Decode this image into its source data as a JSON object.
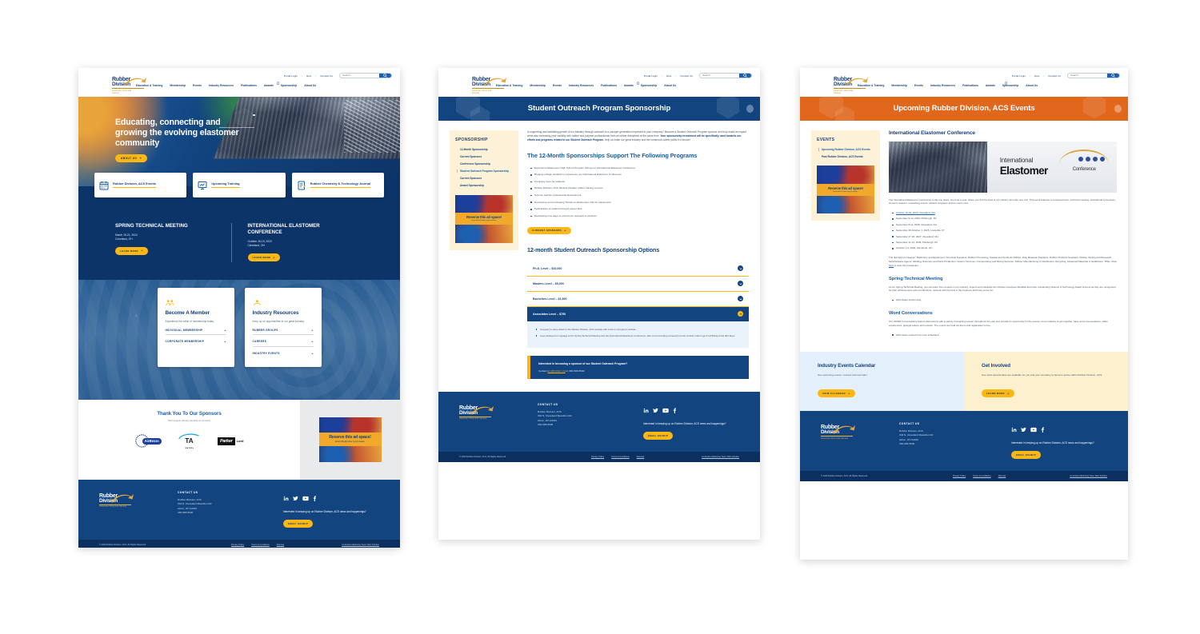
{
  "site": {
    "utility": {
      "portal_login": "Portal Login",
      "give": "Give",
      "contact": "Contact Us",
      "sep": "|"
    },
    "search": {
      "placeholder": "Search...",
      "value": "",
      "icon": "search-icon"
    },
    "logo": {
      "line1": "Rubber",
      "line2": "Division",
      "tagline": "American Chemical Society"
    },
    "nav": [
      "Education & Training",
      "Membership",
      "Events",
      "Industry Resources",
      "Publications",
      "Awards",
      "Sponsorship",
      "About Us"
    ]
  },
  "ad": {
    "headline": "Reserve this ad space!",
    "subline": "Email office@rubber.org for details."
  },
  "home": {
    "hero": {
      "heading": "Educating, connecting and growing the evolving elastomer community",
      "cta": "ABOUT US"
    },
    "quick_cards": [
      {
        "label": "Rubber Division, ACS Events",
        "icon": "calendar-icon"
      },
      {
        "label": "Upcoming Training",
        "icon": "presentation-icon"
      },
      {
        "label": "Rubber Chemistry & Technology Journal",
        "icon": "journal-icon"
      }
    ],
    "events": [
      {
        "title": "SPRING TECHNICAL MEETING",
        "date": "March 19-21, 2024",
        "location": "Columbus, OH",
        "cta": "LEARN MORE"
      },
      {
        "title": "INTERNATIONAL ELASTOMER CONFERENCE",
        "date": "October 16-19, 2023",
        "location": "Cleveland, OH",
        "cta": "LEARN MORE"
      }
    ],
    "member_cards": [
      {
        "icon": "people-icon",
        "title": "Become A Member",
        "desc": "Experience the value of membership today.",
        "links": [
          "INDIVIDUAL MEMBERSHIP",
          "CORPORATE MEMBERSHIP"
        ]
      },
      {
        "icon": "handshake-icon",
        "title": "Industry Resources",
        "desc": "Keep up on opportunities in our great industry.",
        "links": [
          "RUBBER GROUPS",
          "CAREERS",
          "INDUSTRY EVENTS"
        ]
      }
    ],
    "sponsors": {
      "title": "Thank You To Our Sponsors",
      "subtitle": "Their support directly benefits our industry.",
      "logos": [
        "AirBoss Rubber Solutions",
        "TA Instruments",
        "Parker Lord"
      ]
    }
  },
  "sponsorship_page": {
    "banner": "Student Outreach Program Sponsorship",
    "sidebar": {
      "title": "SPONSORSHIP",
      "items": [
        {
          "label": "12-Month Sponsorship",
          "active": false
        },
        {
          "label": "Current Sponsors",
          "active": false
        },
        {
          "label": "Conference Sponsorship",
          "active": false
        },
        {
          "label": "Student Outreach Program Sponsorship",
          "active": true
        },
        {
          "label": "Current Sponsors",
          "active": false
        },
        {
          "label": "Award Sponsorship",
          "active": false
        }
      ]
    },
    "intro_a": "Is supporting and facilitating growth of our industry through outreach to a younger generation important to your company? Become a Student Outreach Program sponsor and truly make an impact while also increasing your visibility with rubber and polymer professionals from all rubber disciplines at the same time.",
    "intro_b": "Your sponsorship investment will be specifically used towards our efforts and programs related to our Student Outreach Program.",
    "intro_c": " Help us make our great industry and the numerous career paths in it known!",
    "programs_heading": "The 12-Month Sponsorships Support The Following Programs",
    "programs": [
      "Experience Elastomers High School Program during our International Elastomer Conference",
      "Bringing college students to experience our International Elastomer Conference",
      "Company tours for students",
      "Rubber Division, ACS Student Chapter rubber training courses",
      "Science teacher professional development",
      "Developing and purchasing 'Hands-on Elastomers' kits for classrooms",
      "Participation at student focused career fairs",
      "Developing new ways to extend our outreach to students"
    ],
    "current_sponsors_cta": "CURRENT SPONSORS",
    "options_heading": "12-month Student Outreach Sponsorship Options",
    "options": [
      {
        "label": "Ph.D. Level – $10,000",
        "open": false
      },
      {
        "label": "Masters Level – $5,000",
        "open": false
      },
      {
        "label": "Bachelors Level – $1,500",
        "open": false
      },
      {
        "label": "Associates Level – $750",
        "open": true
      }
    ],
    "open_option_details": [
      "Company's name listed on the Rubber Division, ACS website with a link to company's website",
      "Logo displayed on signage at the Spring Technical Meeting and the International Elastomer Conference, also communicating company's booth number under logo if exhibiting at the IEC Expo"
    ],
    "cta_box": {
      "heading": "Interested in becoming a sponsor of our Student Outreach Program?",
      "contact_prefix": "Contact ",
      "contact_email": "acs@rubber.org",
      "contact_suffix": " or 330-595-5540."
    }
  },
  "events_page": {
    "banner": "Upcoming Rubber Division, ACS Events",
    "sidebar": {
      "title": "EVENTS",
      "items": [
        {
          "label": "Upcoming Rubber Division, ACS Events",
          "active": true
        },
        {
          "label": "Past Rubber Division, ACS Events",
          "active": false
        }
      ]
    },
    "iec": {
      "title": "International Elastomer Conference",
      "image_alt": "International Elastomer Conference banner at expo",
      "logo_text": {
        "international": "International",
        "elastomer": "Elastomer",
        "conference": "Conference"
      },
      "description": "The International Elastomer Conference is the one place, one time a year, where you find the best of our industry all under one roof. This event features a renowned expo, technical meeting, educational symposium, women's session, networking events, student programs and so much more.",
      "dates": [
        {
          "text": "October 16-19, 2023; Cleveland, OH",
          "link": true
        },
        {
          "text": "September 9-12, 2024; Pittsburgh, PA",
          "link": false
        },
        {
          "text": "September 8-11, 2025; Cleveland, OH",
          "link": false
        },
        {
          "text": "September 28-October 1, 2026; Louisville, KY",
          "link": false
        },
        {
          "text": "September 27-30, 2027; Cleveland, OH",
          "link": false
        },
        {
          "text": "September 11-14, 2028; Pittsburgh, PA",
          "link": false
        },
        {
          "text": "October 1-4, 2029; Cleveland, OH",
          "link": false
        }
      ],
      "expo_text_a": "The IEC Expo is ideal for: Machinery and Equipment, Chemical Suppliers, Rubber Processing, Natural and Synthetic Rubber, Raw Materials Suppliers, Rubber Products Suppliers, Rubber Testing and Research, Mold Release Agents, Molding, Extrusion and Parts Production, Custom Services, Compounding and Mixing Services, Rubber Manufacturing or Distribution, Recycling, Advanced Materials in Healthcare, TPEs. Click ",
      "expo_link": "here",
      "expo_text_b": " to view the prospectus."
    },
    "stm": {
      "title": "Spring Technical Meeting",
      "description": "At our Spring Technical Meeting, you can learn from experts in our industry, support and celebrate the Charles Goodyear Medalist and other outstanding Science & Technology Award winners as they are recognized for their achievements and contributions, network with the best in the business and have some fun.",
      "bullets": [
        "2024 dates forthcoming"
      ]
    },
    "word": {
      "title": "Word Conversations",
      "description": "Our WORD Conversations feature discussions with a variety of amazing women throughout the year and provide an opportunity for the women of our industry to get together, have some conversations, share experiences, give/get advice and network. The events are held via Zoom and registration is free.",
      "bullets": [
        "2024 dates posted here once scheduled"
      ]
    },
    "promos": [
      {
        "title": "Industry Events Calendar",
        "desc": "See upcoming events, courses and seminars.",
        "cta": "VIEW CALENDAR"
      },
      {
        "title": "Get Involved",
        "desc": "See what opportunities are available for you and your company to become active within Rubber Division, ACS.",
        "cta": "LEARN MORE"
      }
    ]
  },
  "footer": {
    "contact_heading": "CONTACT US",
    "address": [
      "Rubber Division, ACS",
      "304 N. Cleveland Massillon Rd",
      "Akron, OH 44333",
      "330-595-5530"
    ],
    "socials": [
      "linkedin-icon",
      "twitter-icon",
      "youtube-icon",
      "facebook-icon"
    ],
    "signup_text": "Interested in keeping up on Rubber Division, ACS news and happenings?",
    "signup_cta": "EMAIL SIGNUP",
    "copyright": "© 2023 Rubber Division, ACS. All Rights Reserved.",
    "links": [
      "Privacy Policy",
      "Terms & Conditions",
      "Sitemap"
    ],
    "credit": "An Evolve Marketing Team Web Solution"
  },
  "colors": {
    "brand_navy": "#12447f",
    "brand_blue": "#1b5fa8",
    "accent_yellow": "#fcb714",
    "accent_orange": "#e0671b",
    "light_blue_panel": "#e4f0fb",
    "cream_panel": "#fdf0cf"
  }
}
